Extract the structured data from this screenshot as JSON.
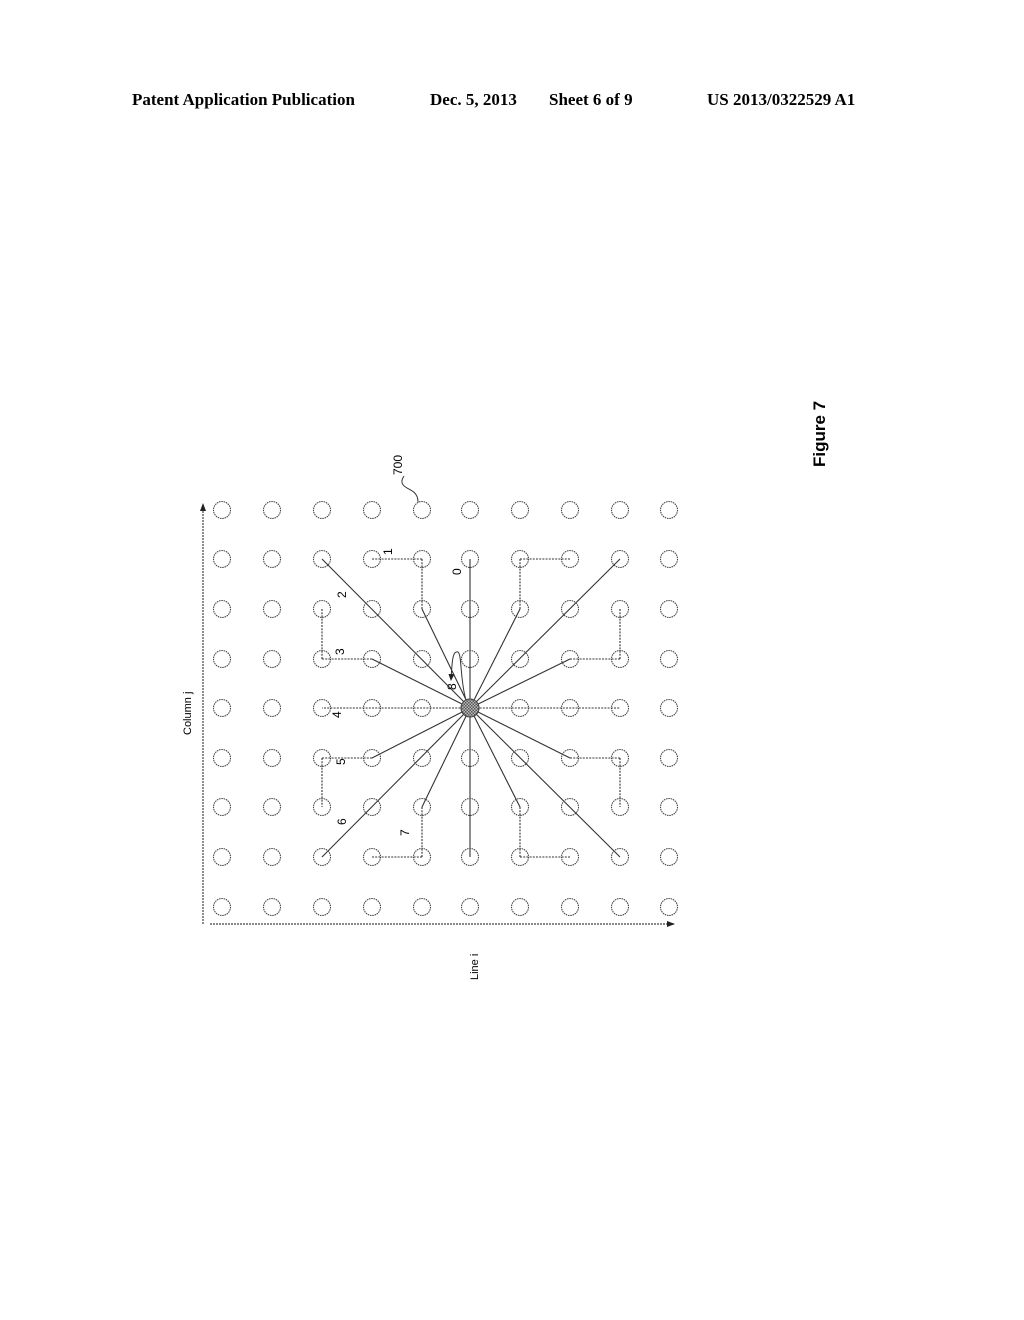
{
  "header": {
    "publication": "Patent Application Publication",
    "date": "Dec. 5, 2013",
    "sheet": "Sheet 6 of 9",
    "patent_number": "US 2013/0322529 A1"
  },
  "figure": {
    "title": "Figure 7",
    "reference_numeral": "700",
    "x_axis_label": "Line i",
    "y_axis_label": "Column j",
    "grid": {
      "columns": 10,
      "rows": 9,
      "center": {
        "col": 5,
        "row": 4
      }
    },
    "paths": [
      {
        "label": "0",
        "points": [
          [
            5,
            4
          ],
          [
            5,
            1
          ]
        ],
        "style": "solid"
      },
      {
        "label": "1",
        "points": [
          [
            5,
            4
          ],
          [
            4,
            2
          ],
          [
            4,
            1
          ],
          [
            3,
            1
          ]
        ],
        "style": "mixed"
      },
      {
        "label": "2",
        "points": [
          [
            5,
            4
          ],
          [
            2,
            1
          ]
        ],
        "style": "solid"
      },
      {
        "label": "3",
        "points": [
          [
            5,
            4
          ],
          [
            3,
            3
          ],
          [
            2,
            3
          ],
          [
            2,
            2
          ]
        ],
        "style": "mixed"
      },
      {
        "label": "4",
        "points": [
          [
            5,
            4
          ],
          [
            2,
            4
          ]
        ],
        "style": "dashed"
      },
      {
        "label": "5",
        "points": [
          [
            5,
            4
          ],
          [
            3,
            5
          ],
          [
            2,
            5
          ],
          [
            2,
            6
          ]
        ],
        "style": "mixed"
      },
      {
        "label": "6",
        "points": [
          [
            5,
            4
          ],
          [
            2,
            7
          ]
        ],
        "style": "solid"
      },
      {
        "label": "7",
        "points": [
          [
            5,
            4
          ],
          [
            4,
            6
          ],
          [
            4,
            7
          ],
          [
            3,
            7
          ]
        ],
        "style": "mixed"
      },
      {
        "label": "",
        "points": [
          [
            5,
            4
          ],
          [
            6,
            2
          ],
          [
            6,
            1
          ],
          [
            7,
            1
          ]
        ],
        "style": "mixed"
      },
      {
        "label": "",
        "points": [
          [
            5,
            4
          ],
          [
            8,
            1
          ]
        ],
        "style": "solid"
      },
      {
        "label": "",
        "points": [
          [
            5,
            4
          ],
          [
            7,
            3
          ],
          [
            8,
            3
          ],
          [
            8,
            2
          ]
        ],
        "style": "mixed"
      },
      {
        "label": "",
        "points": [
          [
            5,
            4
          ],
          [
            8,
            4
          ]
        ],
        "style": "dashed"
      },
      {
        "label": "",
        "points": [
          [
            5,
            4
          ],
          [
            7,
            5
          ],
          [
            8,
            5
          ],
          [
            8,
            6
          ]
        ],
        "style": "mixed"
      },
      {
        "label": "",
        "points": [
          [
            5,
            4
          ],
          [
            8,
            7
          ]
        ],
        "style": "solid"
      },
      {
        "label": "",
        "points": [
          [
            5,
            4
          ],
          [
            6,
            6
          ],
          [
            6,
            7
          ],
          [
            7,
            7
          ]
        ],
        "style": "mixed"
      },
      {
        "label": "",
        "points": [
          [
            5,
            4
          ],
          [
            5,
            7
          ]
        ],
        "style": "solid"
      }
    ],
    "self_loop_label": "8",
    "path_label_positions": {
      "0": [
        461,
        575
      ],
      "1": [
        392,
        555
      ],
      "2": [
        346,
        598
      ],
      "3": [
        344,
        655
      ],
      "4": [
        341,
        718
      ],
      "5": [
        345,
        765
      ],
      "6": [
        346,
        825
      ],
      "7": [
        409,
        836
      ]
    }
  }
}
